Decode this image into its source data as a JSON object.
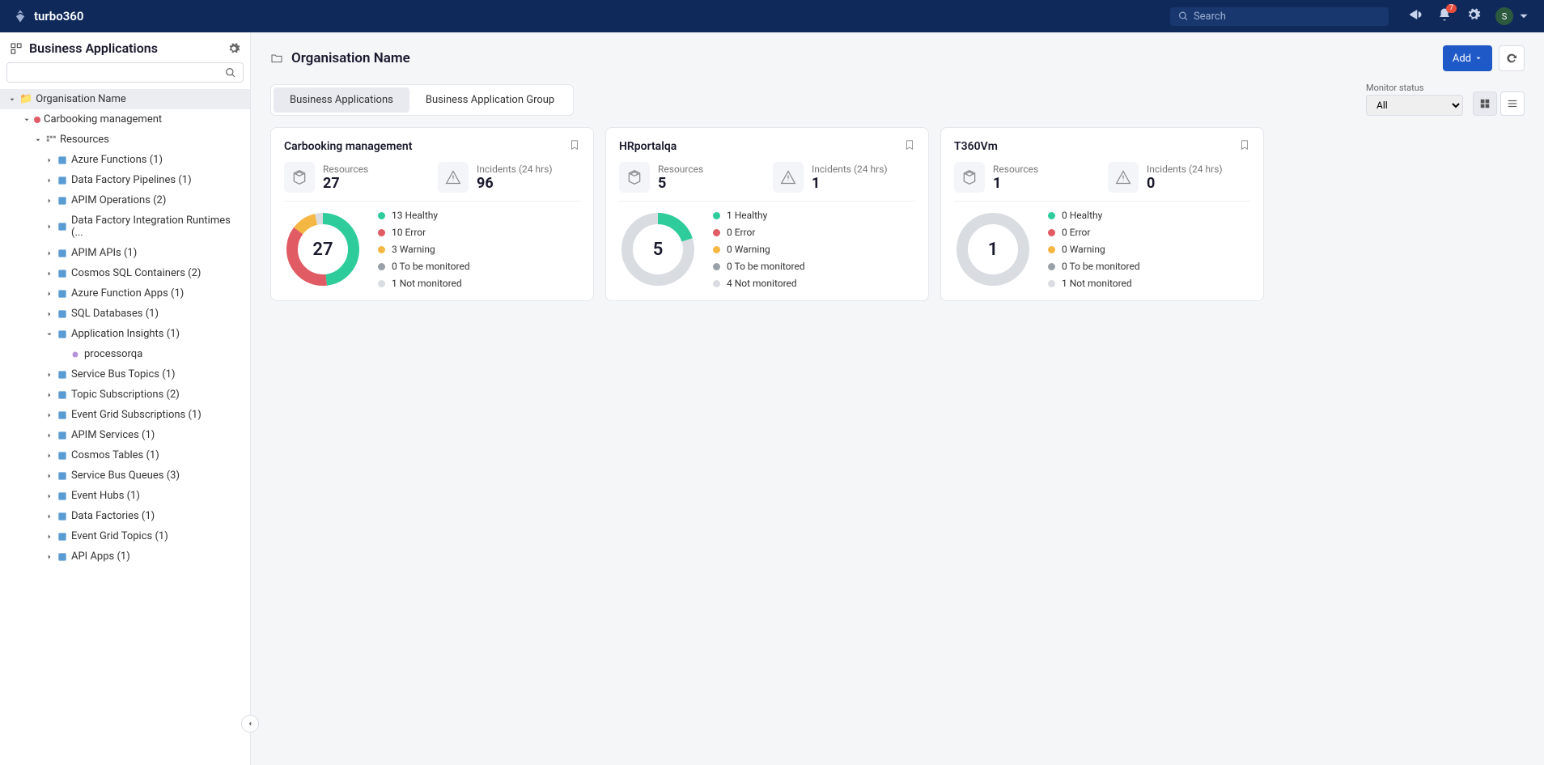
{
  "header": {
    "brand": "turbo360",
    "search_placeholder": "Search",
    "notif_badge": "7",
    "avatar_initial": "S"
  },
  "sidebar": {
    "title": "Business Applications",
    "root": "Organisation Name",
    "app": "Carbooking management",
    "resources_label": "Resources",
    "items": [
      {
        "label": "Azure Functions (1)"
      },
      {
        "label": "Data Factory Pipelines (1)"
      },
      {
        "label": "APIM Operations (2)"
      },
      {
        "label": "Data Factory Integration Runtimes (..."
      },
      {
        "label": "APIM APIs (1)"
      },
      {
        "label": "Cosmos SQL Containers (2)"
      },
      {
        "label": "Azure Function Apps (1)"
      },
      {
        "label": "SQL Databases (1)"
      },
      {
        "label": "Application Insights (1)",
        "expanded": true
      },
      {
        "label": "Service Bus Topics (1)"
      },
      {
        "label": "Topic Subscriptions (2)"
      },
      {
        "label": "Event Grid Subscriptions (1)"
      },
      {
        "label": "APIM Services (1)"
      },
      {
        "label": "Cosmos Tables (1)"
      },
      {
        "label": "Service Bus Queues (3)"
      },
      {
        "label": "Event Hubs (1)"
      },
      {
        "label": "Data Factories (1)"
      },
      {
        "label": "Event Grid Topics (1)"
      },
      {
        "label": "API Apps (1)"
      }
    ],
    "child_item": "processorqa"
  },
  "page": {
    "title": "Organisation Name",
    "add_label": "Add",
    "tabs": [
      "Business Applications",
      "Business Application Group"
    ],
    "filter_label": "Monitor status",
    "filter_value": "All"
  },
  "colors": {
    "healthy": "#2ecc9a",
    "error": "#e15b64",
    "warning": "#f5b744",
    "tobemon": "#9aa0a8",
    "notmon": "#d9dce0"
  },
  "cards": [
    {
      "title": "Carbooking management",
      "resources_label": "Resources",
      "resources": "27",
      "incidents_label": "Incidents (24 hrs)",
      "incidents": "96",
      "total": "27",
      "legend": [
        {
          "n": "13",
          "t": "Healthy",
          "c": "healthy"
        },
        {
          "n": "10",
          "t": "Error",
          "c": "error"
        },
        {
          "n": "3",
          "t": "Warning",
          "c": "warning"
        },
        {
          "n": "0",
          "t": "To be monitored",
          "c": "tobemon"
        },
        {
          "n": "1",
          "t": "Not monitored",
          "c": "notmon"
        }
      ]
    },
    {
      "title": "HRportalqa",
      "resources_label": "Resources",
      "resources": "5",
      "incidents_label": "Incidents (24 hrs)",
      "incidents": "1",
      "total": "5",
      "legend": [
        {
          "n": "1",
          "t": "Healthy",
          "c": "healthy"
        },
        {
          "n": "0",
          "t": "Error",
          "c": "error"
        },
        {
          "n": "0",
          "t": "Warning",
          "c": "warning"
        },
        {
          "n": "0",
          "t": "To be monitored",
          "c": "tobemon"
        },
        {
          "n": "4",
          "t": "Not monitored",
          "c": "notmon"
        }
      ]
    },
    {
      "title": "T360Vm",
      "resources_label": "Resources",
      "resources": "1",
      "incidents_label": "Incidents (24 hrs)",
      "incidents": "0",
      "total": "1",
      "legend": [
        {
          "n": "0",
          "t": "Healthy",
          "c": "healthy"
        },
        {
          "n": "0",
          "t": "Error",
          "c": "error"
        },
        {
          "n": "0",
          "t": "Warning",
          "c": "warning"
        },
        {
          "n": "0",
          "t": "To be monitored",
          "c": "tobemon"
        },
        {
          "n": "1",
          "t": "Not monitored",
          "c": "notmon"
        }
      ]
    }
  ],
  "chart_data": [
    {
      "type": "pie",
      "title": "Carbooking management",
      "categories": [
        "Healthy",
        "Error",
        "Warning",
        "To be monitored",
        "Not monitored"
      ],
      "values": [
        13,
        10,
        3,
        0,
        1
      ]
    },
    {
      "type": "pie",
      "title": "HRportalqa",
      "categories": [
        "Healthy",
        "Error",
        "Warning",
        "To be monitored",
        "Not monitored"
      ],
      "values": [
        1,
        0,
        0,
        0,
        4
      ]
    },
    {
      "type": "pie",
      "title": "T360Vm",
      "categories": [
        "Healthy",
        "Error",
        "Warning",
        "To be monitored",
        "Not monitored"
      ],
      "values": [
        0,
        0,
        0,
        0,
        1
      ]
    }
  ]
}
